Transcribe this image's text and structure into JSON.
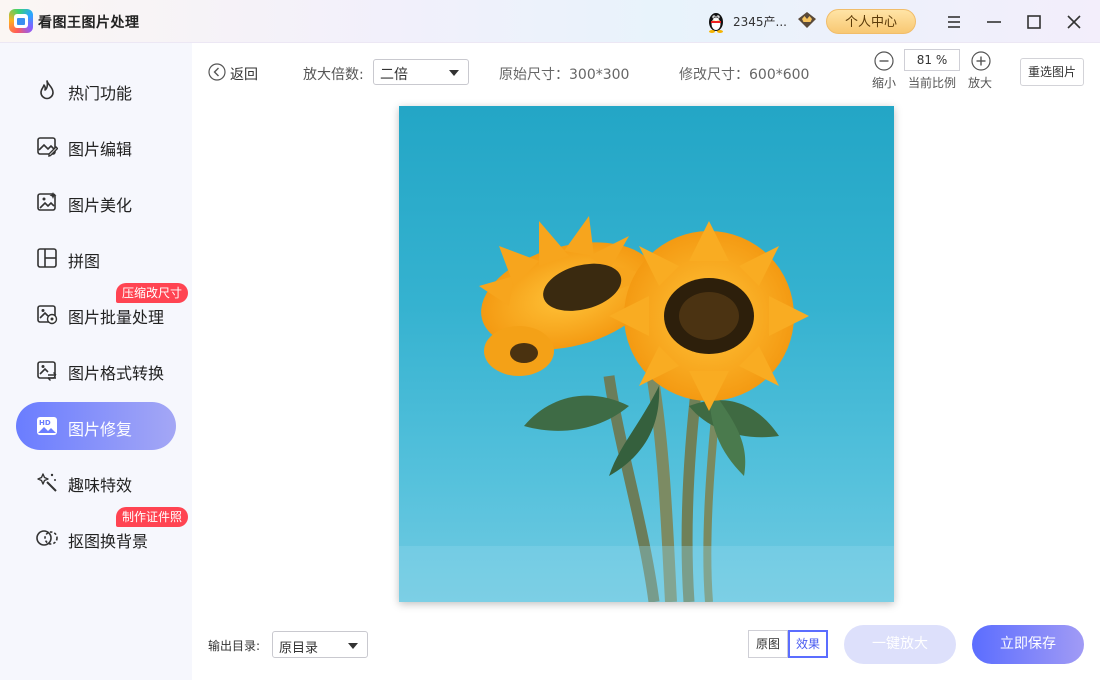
{
  "app": {
    "title": "看图王图片处理"
  },
  "titlebar": {
    "username": "2345产...",
    "vip_label": "个人中心"
  },
  "sidebar": {
    "items": [
      {
        "label": "热门功能",
        "icon": "flame-icon"
      },
      {
        "label": "图片编辑",
        "icon": "image-edit-icon"
      },
      {
        "label": "图片美化",
        "icon": "image-beautify-icon"
      },
      {
        "label": "拼图",
        "icon": "collage-icon"
      },
      {
        "label": "图片批量处理",
        "icon": "image-batch-icon",
        "badge": "压缩改尺寸"
      },
      {
        "label": "图片格式转换",
        "icon": "image-convert-icon"
      },
      {
        "label": "图片修复",
        "icon": "hd-image-icon",
        "active": true
      },
      {
        "label": "趣味特效",
        "icon": "magic-wand-icon"
      },
      {
        "label": "抠图换背景",
        "icon": "cutout-icon",
        "badge": "制作证件照"
      }
    ]
  },
  "toolbar": {
    "back_label": "返回",
    "scale_label": "放大倍数:",
    "scale_value": "二倍",
    "original_size": "原始尺寸：300*300",
    "modified_size": "修改尺寸：600*600",
    "zoom_out_label": "缩小",
    "zoom_value": "81 %",
    "zoom_current_label": "当前比例",
    "zoom_in_label": "放大",
    "reselect_label": "重选图片"
  },
  "bottom": {
    "output_label": "输出目录:",
    "output_value": "原目录",
    "view_original": "原图",
    "view_effect": "效果",
    "enlarge_label": "一键放大",
    "save_label": "立即保存"
  },
  "colors": {
    "accent": "#5b6dff",
    "badge": "#ff4452",
    "vip": "#f8c873"
  }
}
